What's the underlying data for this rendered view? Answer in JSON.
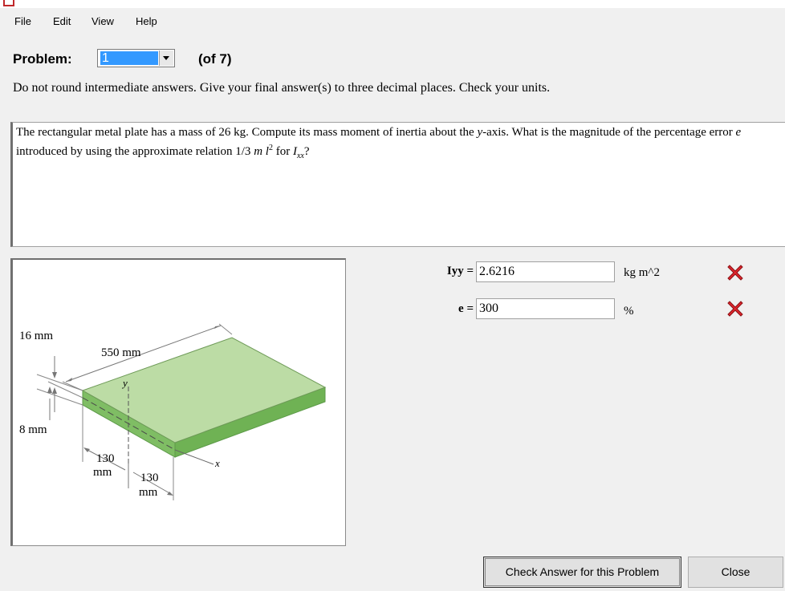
{
  "menu": {
    "items": [
      {
        "label": "File"
      },
      {
        "label": "Edit"
      },
      {
        "label": "View"
      },
      {
        "label": "Help"
      }
    ]
  },
  "problem_selector": {
    "label": "Problem:",
    "selected_value": "1",
    "of_text": "(of 7)"
  },
  "instructions": "Do not round intermediate answers.  Give your final answer(s) to three decimal places.  Check your units.",
  "problem_text": {
    "part1": "The rectangular metal plate has a mass of 26 kg. Compute its mass moment of inertia about the ",
    "axis_y": "y",
    "part2": "-axis. What is the magnitude of the percentage error ",
    "e_symbol": "e",
    "part3": " introduced by using the approximate relation 1/3 ",
    "m_symbol": "m",
    "l_symbol": "l",
    "sup2": "2",
    "part4": " for ",
    "I_symbol": "I",
    "sub_xx": "xx",
    "part5": "?"
  },
  "figure": {
    "dim_thickness": "16 mm",
    "dim_length": "550 mm",
    "dim_half_thickness": "8 mm",
    "dim_width1_top": "130",
    "dim_width1_bottom": "mm",
    "dim_width2_top": "130",
    "dim_width2_bottom": "mm",
    "axis_y": "y",
    "axis_x": "x",
    "plate_top_color": "#bcdca5",
    "plate_side_color": "#6fb254"
  },
  "answers": [
    {
      "label": "Iyy =",
      "value": "2.6216",
      "unit": "kg m^2",
      "status": "incorrect"
    },
    {
      "label": "e =",
      "value": "300",
      "unit": "%",
      "status": "incorrect"
    }
  ],
  "buttons": {
    "check": "Check Answer for this Problem",
    "close": "Close"
  },
  "colors": {
    "incorrect_mark": "#e0262d",
    "selection": "#3399ff"
  }
}
